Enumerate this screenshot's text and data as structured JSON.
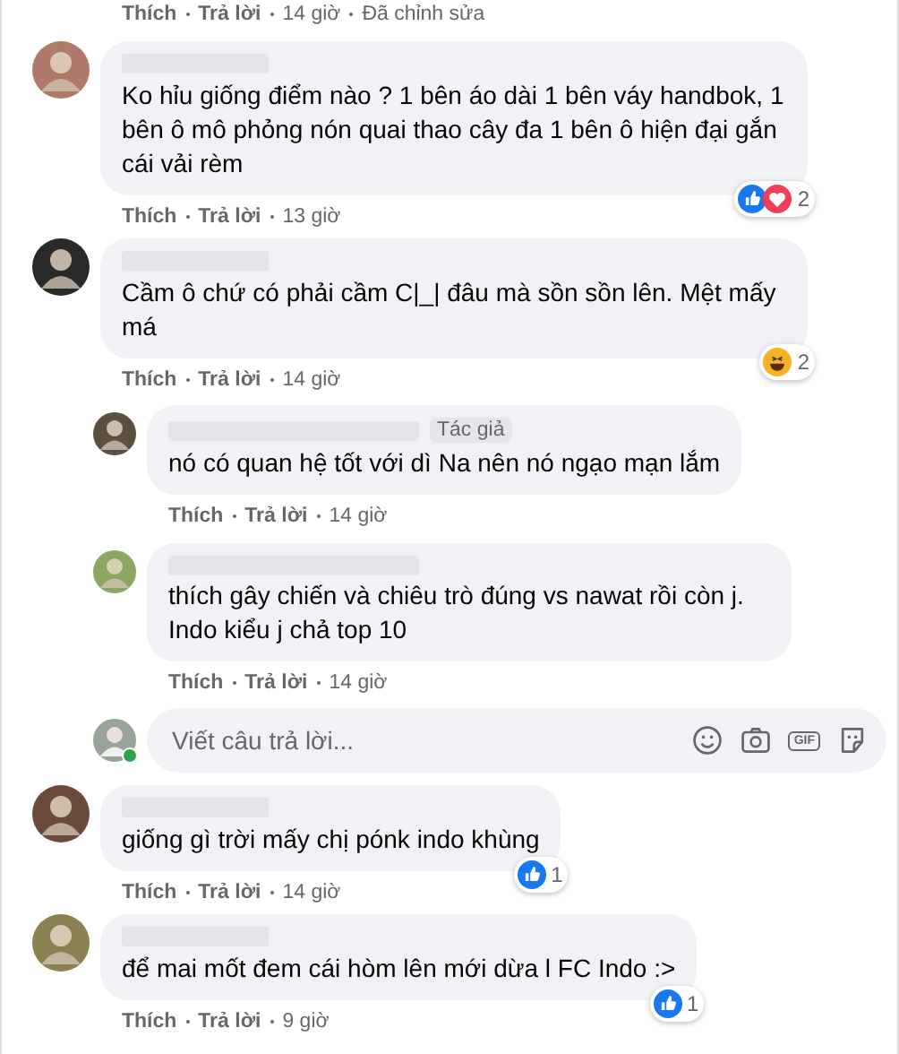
{
  "top_meta": {
    "like": "Thích",
    "reply": "Trả lời",
    "time": "14 giờ",
    "edited": "Đã chỉnh sửa"
  },
  "comments": [
    {
      "text": "Ko hỉu giống điểm nào ? 1 bên áo dài 1 bên váy handbok, 1 bên ô mô phỏng nón quai thao cây đa 1 bên ô hiện đại gắn cái vải rèm",
      "reactions": {
        "icons": [
          {
            "kind": "like"
          },
          {
            "kind": "love"
          }
        ],
        "count": "2"
      },
      "meta": {
        "like": "Thích",
        "reply": "Trả lời",
        "time": "13 giờ"
      }
    },
    {
      "text": "Cầm ô chứ có phải cầm C|_| đâu mà sồn sồn lên. Mệt mấy má",
      "reactions": {
        "icons": [
          {
            "kind": "haha"
          }
        ],
        "count": "2"
      },
      "meta": {
        "like": "Thích",
        "reply": "Trả lời",
        "time": "14 giờ"
      },
      "replies": [
        {
          "badge": "Tác giả",
          "text": "nó có quan hệ tốt với dì Na nên nó ngạo mạn lắm",
          "meta": {
            "like": "Thích",
            "reply": "Trả lời",
            "time": "14 giờ"
          }
        },
        {
          "text": "thích gây chiến và chiêu trò đúng vs nawat rồi còn j. Indo kiểu j chả top 10",
          "meta": {
            "like": "Thích",
            "reply": "Trả lời",
            "time": "14 giờ"
          }
        }
      ],
      "reply_box": {
        "online": true,
        "placeholder": "Viết câu trả lời...",
        "gif_label": "GIF"
      }
    },
    {
      "text": "giống gì trời mấy chị pónk indo khùng",
      "reactions": {
        "icons": [
          {
            "kind": "like"
          }
        ],
        "count": "1"
      },
      "meta": {
        "like": "Thích",
        "reply": "Trả lời",
        "time": "14 giờ"
      }
    },
    {
      "text": "để mai mốt đem cái hòm lên mới dừa l FC Indo :>",
      "reactions": {
        "icons": [
          {
            "kind": "like"
          }
        ],
        "count": "1"
      },
      "meta": {
        "like": "Thích",
        "reply": "Trả lời",
        "time": "9 giờ"
      }
    }
  ]
}
